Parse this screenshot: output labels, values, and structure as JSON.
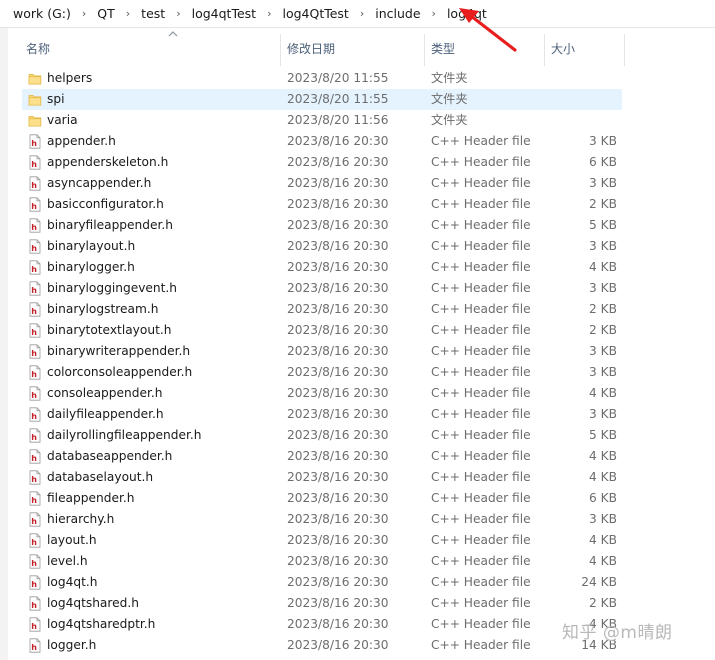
{
  "breadcrumb": [
    "work (G:)",
    "QT",
    "test",
    "log4qtTest",
    "log4QtTest",
    "include",
    "log4qt"
  ],
  "header": {
    "name": "名称",
    "date": "修改日期",
    "type": "类型",
    "size": "大小"
  },
  "colors": {
    "accent": "#e81e1e",
    "selection": "#e5f3ff",
    "folder": "#f8d775",
    "header_icon_red": "#c8202a"
  },
  "files": [
    {
      "name": "helpers",
      "date": "2023/8/20 11:55",
      "type": "文件夹",
      "size": "",
      "icon": "folder-icon"
    },
    {
      "name": "spi",
      "date": "2023/8/20 11:55",
      "type": "文件夹",
      "size": "",
      "icon": "folder-icon",
      "selected": true
    },
    {
      "name": "varia",
      "date": "2023/8/20 11:56",
      "type": "文件夹",
      "size": "",
      "icon": "folder-icon"
    },
    {
      "name": "appender.h",
      "date": "2023/8/16 20:30",
      "type": "C++ Header file",
      "size": "3 KB",
      "icon": "header-file-icon"
    },
    {
      "name": "appenderskeleton.h",
      "date": "2023/8/16 20:30",
      "type": "C++ Header file",
      "size": "6 KB",
      "icon": "header-file-icon"
    },
    {
      "name": "asyncappender.h",
      "date": "2023/8/16 20:30",
      "type": "C++ Header file",
      "size": "3 KB",
      "icon": "header-file-icon"
    },
    {
      "name": "basicconfigurator.h",
      "date": "2023/8/16 20:30",
      "type": "C++ Header file",
      "size": "2 KB",
      "icon": "header-file-icon"
    },
    {
      "name": "binaryfileappender.h",
      "date": "2023/8/16 20:30",
      "type": "C++ Header file",
      "size": "5 KB",
      "icon": "header-file-icon"
    },
    {
      "name": "binarylayout.h",
      "date": "2023/8/16 20:30",
      "type": "C++ Header file",
      "size": "3 KB",
      "icon": "header-file-icon"
    },
    {
      "name": "binarylogger.h",
      "date": "2023/8/16 20:30",
      "type": "C++ Header file",
      "size": "4 KB",
      "icon": "header-file-icon"
    },
    {
      "name": "binaryloggingevent.h",
      "date": "2023/8/16 20:30",
      "type": "C++ Header file",
      "size": "3 KB",
      "icon": "header-file-icon"
    },
    {
      "name": "binarylogstream.h",
      "date": "2023/8/16 20:30",
      "type": "C++ Header file",
      "size": "2 KB",
      "icon": "header-file-icon"
    },
    {
      "name": "binarytotextlayout.h",
      "date": "2023/8/16 20:30",
      "type": "C++ Header file",
      "size": "2 KB",
      "icon": "header-file-icon"
    },
    {
      "name": "binarywriterappender.h",
      "date": "2023/8/16 20:30",
      "type": "C++ Header file",
      "size": "3 KB",
      "icon": "header-file-icon"
    },
    {
      "name": "colorconsoleappender.h",
      "date": "2023/8/16 20:30",
      "type": "C++ Header file",
      "size": "3 KB",
      "icon": "header-file-icon"
    },
    {
      "name": "consoleappender.h",
      "date": "2023/8/16 20:30",
      "type": "C++ Header file",
      "size": "4 KB",
      "icon": "header-file-icon"
    },
    {
      "name": "dailyfileappender.h",
      "date": "2023/8/16 20:30",
      "type": "C++ Header file",
      "size": "3 KB",
      "icon": "header-file-icon"
    },
    {
      "name": "dailyrollingfileappender.h",
      "date": "2023/8/16 20:30",
      "type": "C++ Header file",
      "size": "5 KB",
      "icon": "header-file-icon"
    },
    {
      "name": "databaseappender.h",
      "date": "2023/8/16 20:30",
      "type": "C++ Header file",
      "size": "4 KB",
      "icon": "header-file-icon"
    },
    {
      "name": "databaselayout.h",
      "date": "2023/8/16 20:30",
      "type": "C++ Header file",
      "size": "4 KB",
      "icon": "header-file-icon"
    },
    {
      "name": "fileappender.h",
      "date": "2023/8/16 20:30",
      "type": "C++ Header file",
      "size": "6 KB",
      "icon": "header-file-icon"
    },
    {
      "name": "hierarchy.h",
      "date": "2023/8/16 20:30",
      "type": "C++ Header file",
      "size": "3 KB",
      "icon": "header-file-icon"
    },
    {
      "name": "layout.h",
      "date": "2023/8/16 20:30",
      "type": "C++ Header file",
      "size": "4 KB",
      "icon": "header-file-icon"
    },
    {
      "name": "level.h",
      "date": "2023/8/16 20:30",
      "type": "C++ Header file",
      "size": "4 KB",
      "icon": "header-file-icon"
    },
    {
      "name": "log4qt.h",
      "date": "2023/8/16 20:30",
      "type": "C++ Header file",
      "size": "24 KB",
      "icon": "header-file-icon"
    },
    {
      "name": "log4qtshared.h",
      "date": "2023/8/16 20:30",
      "type": "C++ Header file",
      "size": "2 KB",
      "icon": "header-file-icon"
    },
    {
      "name": "log4qtsharedptr.h",
      "date": "2023/8/16 20:30",
      "type": "C++ Header file",
      "size": "4 KB",
      "icon": "header-file-icon"
    },
    {
      "name": "logger.h",
      "date": "2023/8/16 20:30",
      "type": "C++ Header file",
      "size": "14 KB",
      "icon": "header-file-icon"
    }
  ],
  "watermark": "知乎 @m晴朗"
}
